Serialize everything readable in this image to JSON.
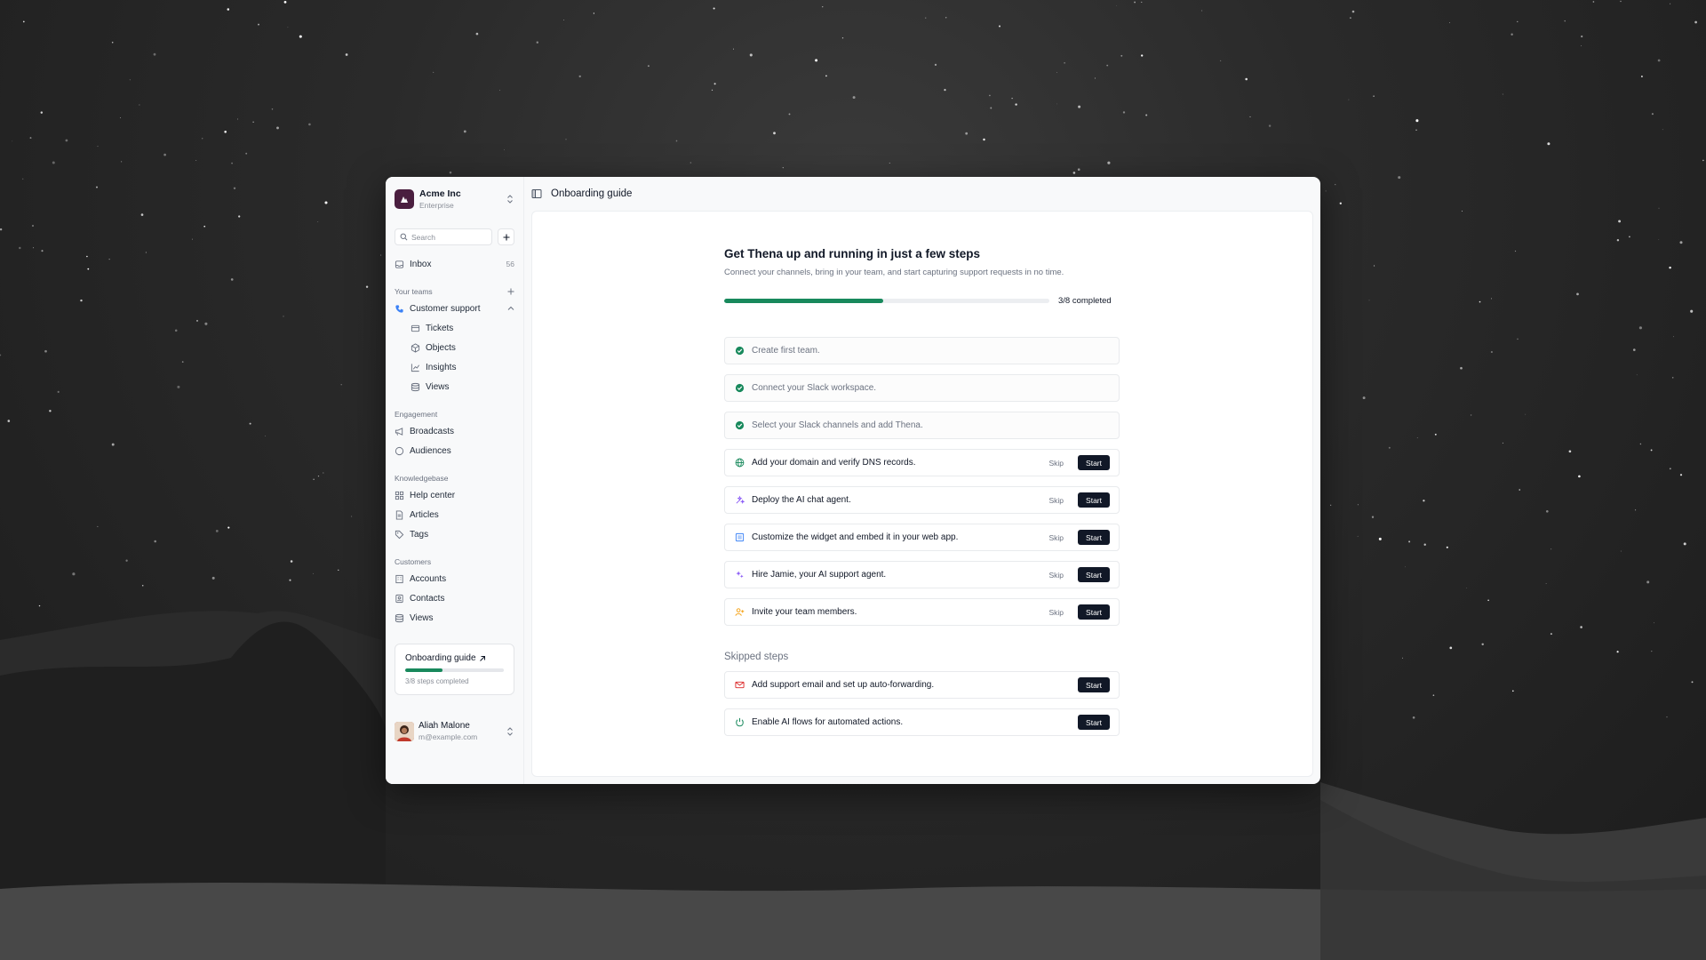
{
  "org": {
    "name": "Acme Inc",
    "plan": "Enterprise"
  },
  "search": {
    "placeholder": "Search"
  },
  "inbox": {
    "label": "Inbox",
    "count": "56"
  },
  "teams": {
    "section_label": "Your teams",
    "team_name": "Customer support",
    "items": [
      {
        "label": "Tickets",
        "icon": "ticket-icon"
      },
      {
        "label": "Objects",
        "icon": "cube-icon"
      },
      {
        "label": "Insights",
        "icon": "chart-icon"
      },
      {
        "label": "Views",
        "icon": "layers-icon"
      }
    ]
  },
  "engagement": {
    "section_label": "Engagement",
    "items": [
      {
        "label": "Broadcasts",
        "icon": "megaphone-icon"
      },
      {
        "label": "Audiences",
        "icon": "circle-icon"
      }
    ]
  },
  "knowledgebase": {
    "section_label": "Knowledgebase",
    "items": [
      {
        "label": "Help center",
        "icon": "grid-icon"
      },
      {
        "label": "Articles",
        "icon": "document-icon"
      },
      {
        "label": "Tags",
        "icon": "tag-icon"
      }
    ]
  },
  "customers": {
    "section_label": "Customers",
    "items": [
      {
        "label": "Accounts",
        "icon": "building-icon"
      },
      {
        "label": "Contacts",
        "icon": "contact-icon"
      },
      {
        "label": "Views",
        "icon": "layers-icon"
      }
    ]
  },
  "promo": {
    "title": "Onboarding guide",
    "progress": 0.375,
    "subtitle": "3/8 steps completed"
  },
  "user": {
    "name": "Aliah Malone",
    "email": "m@example.com"
  },
  "topbar": {
    "title": "Onboarding guide"
  },
  "guide": {
    "title": "Get Thena up and running in just a few steps",
    "subtitle": "Connect your channels, bring in your team, and start capturing support requests in no time.",
    "progress": 0.49,
    "progress_label": "3/8 completed",
    "skip_label": "Skip",
    "start_label": "Start",
    "completed_steps": [
      "Create first team.",
      "Connect your Slack workspace.",
      "Select your Slack channels and add Thena."
    ],
    "pending_steps": [
      {
        "label": "Add your domain and verify DNS records.",
        "icon": "globe-icon",
        "color": "#18895c"
      },
      {
        "label": "Deploy the AI chat agent.",
        "icon": "sparkle-icon",
        "color": "#8b5cf6"
      },
      {
        "label": "Customize the widget and embed it in your web app.",
        "icon": "widget-icon",
        "color": "#3b82f6"
      },
      {
        "label": "Hire Jamie, your AI support agent.",
        "icon": "stars-icon",
        "color": "#8b5cf6"
      },
      {
        "label": "Invite your team members.",
        "icon": "user-plus-icon",
        "color": "#f59e0b"
      }
    ],
    "skipped_title": "Skipped steps",
    "skipped_steps": [
      {
        "label": "Add support email and set up auto-forwarding.",
        "icon": "mail-icon",
        "color": "#dc2626"
      },
      {
        "label": "Enable AI flows for automated actions.",
        "icon": "power-icon",
        "color": "#18895c"
      }
    ]
  }
}
